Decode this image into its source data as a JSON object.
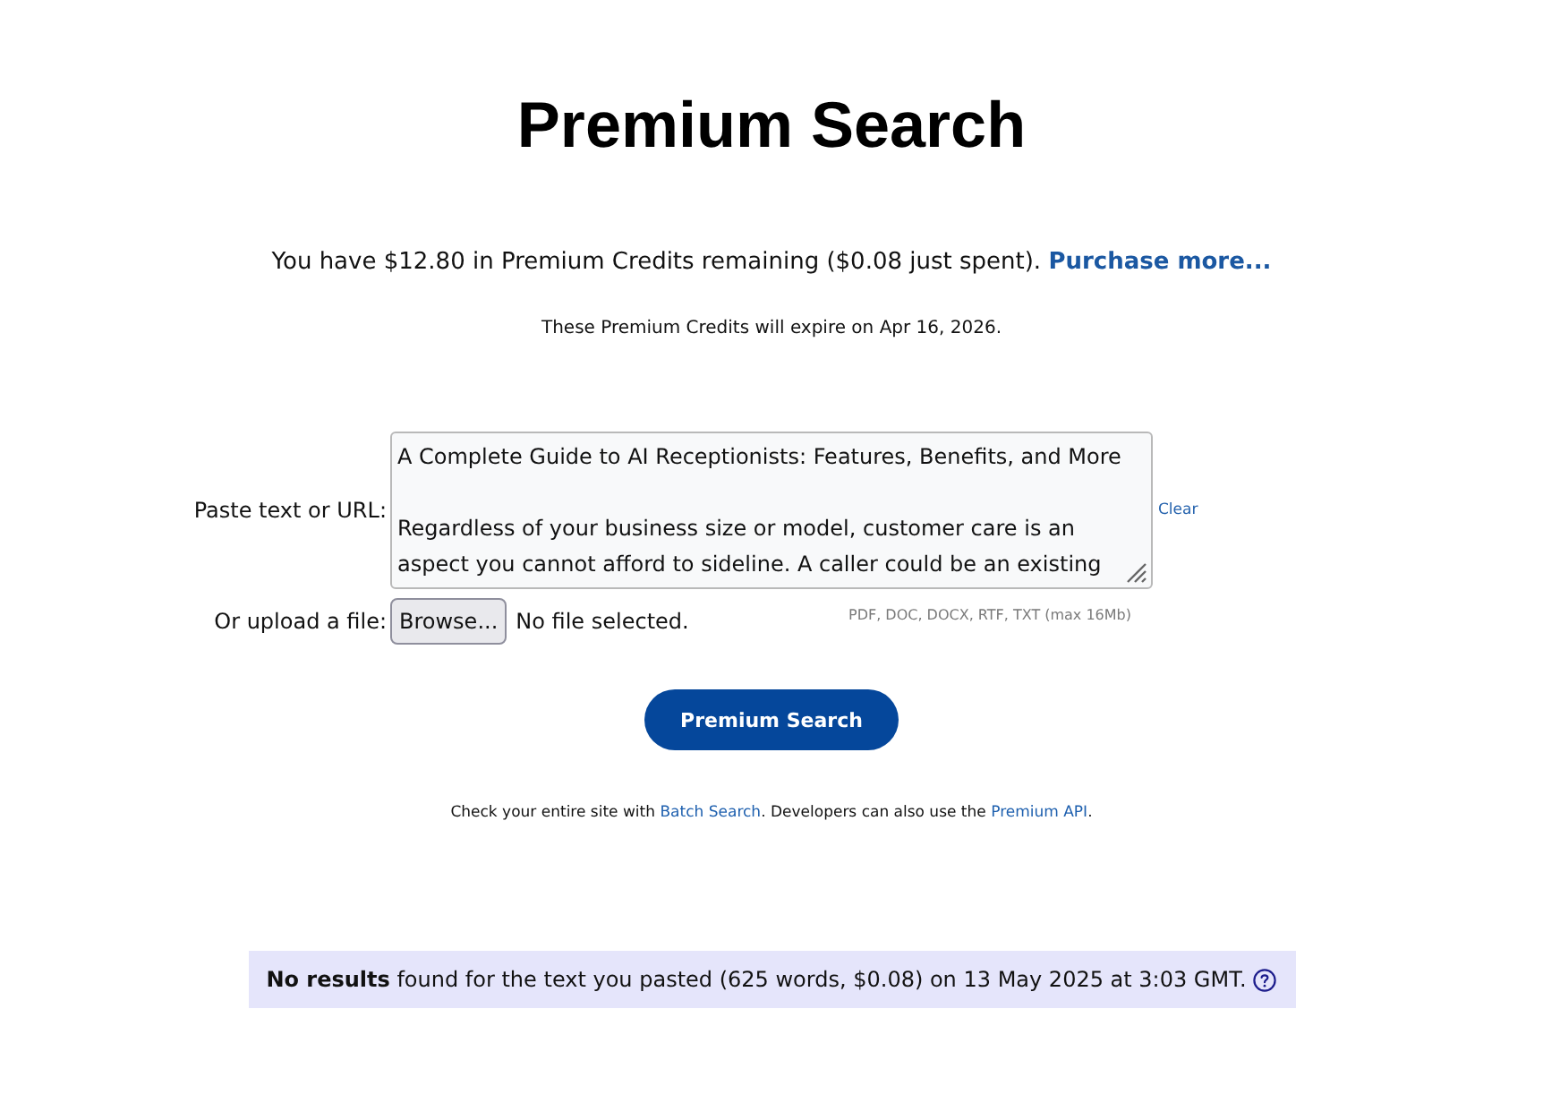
{
  "title": "Premium Search",
  "credits": {
    "text": "You have $12.80 in Premium Credits remaining ($0.08 just spent).",
    "link": "Purchase more...",
    "expiry": "These Premium Credits will expire on Apr 16, 2026."
  },
  "form": {
    "paste_label": "Paste text or URL:",
    "text_value": "A Complete Guide to AI Receptionists: Features, Benefits, and More\n\nRegardless of your business size or model, customer care is an aspect you cannot afford to sideline. A caller could be an existing",
    "clear_link": "Clear",
    "upload_label": "Or upload a file:",
    "browse_button": "Browse...",
    "file_status": "No file selected.",
    "file_hint": "PDF, DOC, DOCX, RTF, TXT (max 16Mb)",
    "submit_button": "Premium Search"
  },
  "footer_note": [
    {
      "kind": "text",
      "text": "Check your entire site with "
    },
    {
      "kind": "link",
      "text": "Batch Search"
    },
    {
      "kind": "text",
      "text": ". Developers can also use the "
    },
    {
      "kind": "link",
      "text": "Premium API"
    },
    {
      "kind": "text",
      "text": "."
    }
  ],
  "result": {
    "text": "**No results** found for the text you pasted (625 words, $0.08) on 13 May 2025 at 3:03 GMT."
  }
}
